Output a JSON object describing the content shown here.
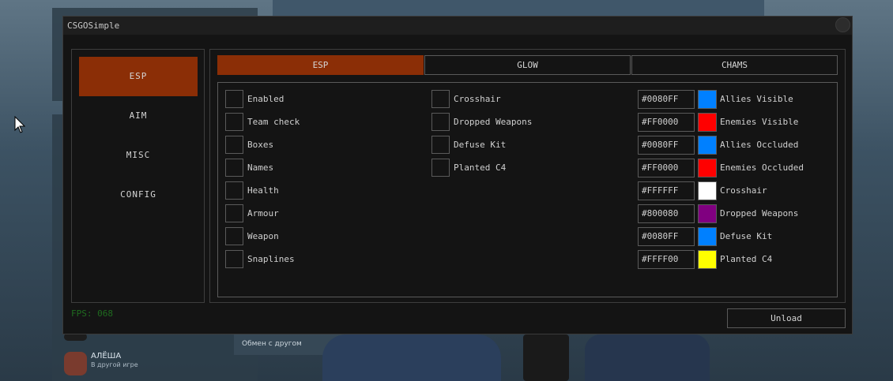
{
  "window": {
    "title": "CSGOSimple"
  },
  "sidebar": {
    "items": [
      {
        "label": "ESP",
        "active": true
      },
      {
        "label": "AIM",
        "active": false
      },
      {
        "label": "MISC",
        "active": false
      },
      {
        "label": "CONFIG",
        "active": false
      }
    ]
  },
  "tabs": [
    {
      "label": "ESP",
      "active": true
    },
    {
      "label": "GLOW",
      "active": false
    },
    {
      "label": "CHAMS",
      "active": false
    }
  ],
  "esp": {
    "column1": [
      "Enabled",
      "Team check",
      "Boxes",
      "Names",
      "Health",
      "Armour",
      "Weapon",
      "Snaplines"
    ],
    "column2": [
      "Crosshair",
      "Dropped Weapons",
      "Defuse Kit",
      "Planted C4"
    ],
    "colors": [
      {
        "hex": "#0080FF",
        "label": "Allies Visible"
      },
      {
        "hex": "#FF0000",
        "label": "Enemies Visible"
      },
      {
        "hex": "#0080FF",
        "label": "Allies Occluded"
      },
      {
        "hex": "#FF0000",
        "label": "Enemies Occluded"
      },
      {
        "hex": "#FFFFFF",
        "label": "Crosshair"
      },
      {
        "hex": "#800080",
        "label": "Dropped Weapons"
      },
      {
        "hex": "#0080FF",
        "label": "Defuse Kit"
      },
      {
        "hex": "#FFFF00",
        "label": "Planted C4"
      }
    ]
  },
  "footer": {
    "fps": "FPS: 068",
    "unload_label": "Unload"
  },
  "background": {
    "friend_name": "АЛЁША",
    "friend_status": "В другой игре",
    "trade_label": "Обмен с другом"
  },
  "theme": {
    "accent": "#8B2E06",
    "fps_color": "#1F6B1F"
  }
}
